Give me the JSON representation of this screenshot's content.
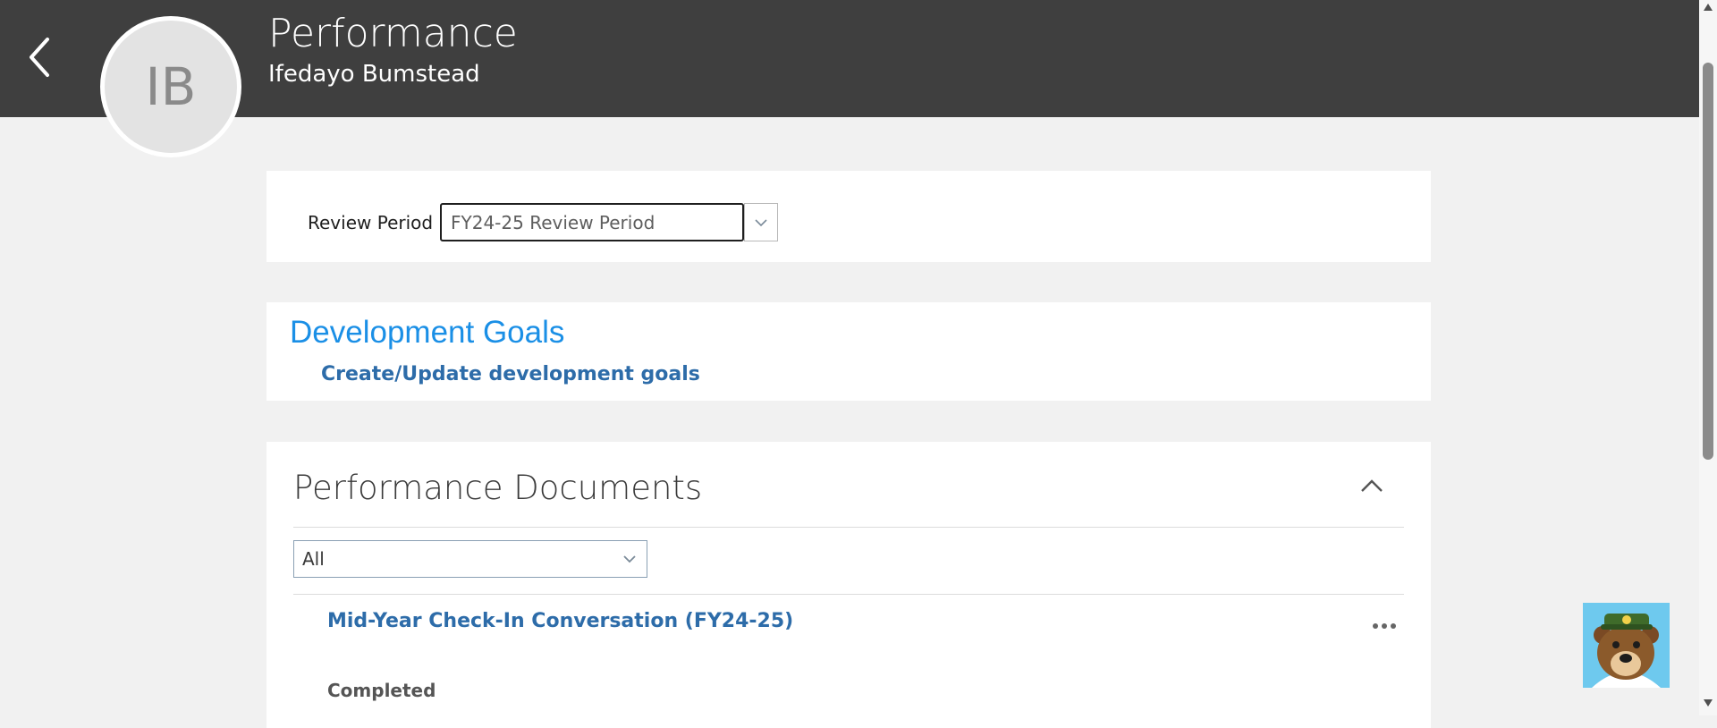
{
  "header": {
    "title": "Performance",
    "subtitle": "Ifedayo Bumstead",
    "avatar_initials": "IB",
    "back_icon": "chevron-left-icon",
    "background": "#3f3f3f"
  },
  "review_period": {
    "label": "Review Period",
    "selected": "FY24-25 Review Period"
  },
  "development_goals": {
    "title": "Development Goals",
    "link": "Create/Update development goals",
    "title_color": "#1a8fe6",
    "link_color": "#2d6ca9"
  },
  "performance_documents": {
    "title": "Performance Documents",
    "filter_value": "All",
    "items": [
      {
        "title": "Mid-Year Check-In Conversation (FY24-25)",
        "status": "Completed"
      }
    ]
  },
  "assistant": {
    "icon": "bear-mascot-icon"
  }
}
